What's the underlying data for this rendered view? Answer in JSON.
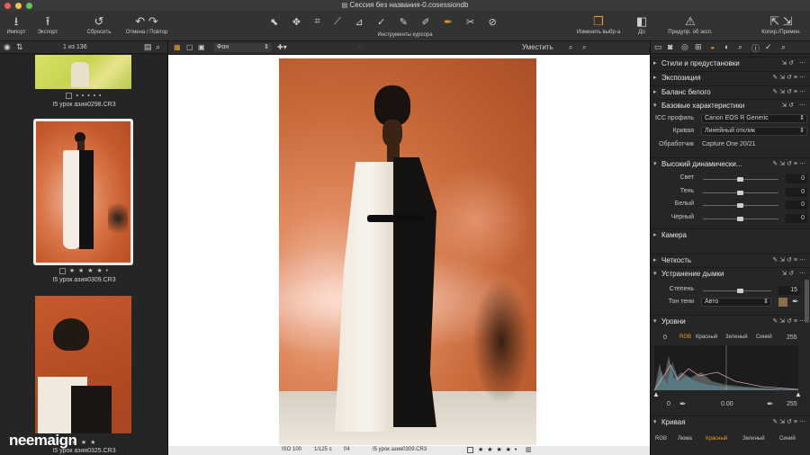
{
  "window": {
    "title": "Сессия без названия-0.cosessiondb"
  },
  "toolbar": {
    "import": "Импорт",
    "export": "Экспорт",
    "reset": "Сбросить",
    "undo_redo": "Отмена / Повтор",
    "cursor_tools": "Инструменты курсора",
    "edit_selection": "Изменить выбр-а",
    "before": "До",
    "preview_warnings": "Предупр. об эксп.",
    "copy_apply": "Копир./Примен."
  },
  "browser": {
    "count": "1 из 136",
    "items": [
      {
        "filename": "I5 урок азия0298.CR3",
        "stars": "• • • • •"
      },
      {
        "filename": "I5 урок азия0309.CR3",
        "stars": "★ ★ ★ ★ •"
      },
      {
        "filename": "I5 урок азия0325.CR3",
        "stars": "★ ★ ★"
      }
    ]
  },
  "viewer": {
    "background_option": "Фон",
    "fit_label": "Уместить",
    "status": {
      "iso": "ISO 100",
      "shutter": "1/125 s",
      "aperture": "f/4",
      "filename": "I5 урок азия0309.CR3",
      "rating": "★ ★ ★ ★ •"
    }
  },
  "tools": {
    "styles": "Стили и предустановки",
    "exposure": "Экспозиция",
    "white_balance": "Баланс белого",
    "base": {
      "title": "Базовые характеристики",
      "icc_label": "ICC профиль",
      "icc_value": "Canon EOS R Generic",
      "curve_label": "Кривая",
      "curve_value": "Линейный отклик",
      "engine_label": "Обработчик",
      "engine_value": "Capture One 20/21"
    },
    "hdr": {
      "title": "Высокий динамически...",
      "rows": [
        {
          "label": "Свет",
          "value": "0"
        },
        {
          "label": "Тень",
          "value": "0"
        },
        {
          "label": "Белый",
          "value": "0"
        },
        {
          "label": "Черный",
          "value": "0"
        }
      ]
    },
    "camera": "Камера",
    "clarity": "Четкость",
    "dehaze": {
      "title": "Устранение дымки",
      "amount_label": "Степень",
      "amount_value": "15",
      "shadow_label": "Тон тени",
      "shadow_value": "Авто"
    },
    "levels": {
      "title": "Уровни",
      "input_low": "0",
      "input_high": "255",
      "channels": [
        "RGB",
        "Красный",
        "Зеленый",
        "Синий"
      ],
      "output_low": "0",
      "gamma": "0.00",
      "output_high": "255"
    },
    "curve": {
      "title": "Кривая",
      "channels": [
        "RGB",
        "Люма",
        "Красный",
        "Зеленый",
        "Синий"
      ]
    }
  },
  "watermark": "neemaign"
}
